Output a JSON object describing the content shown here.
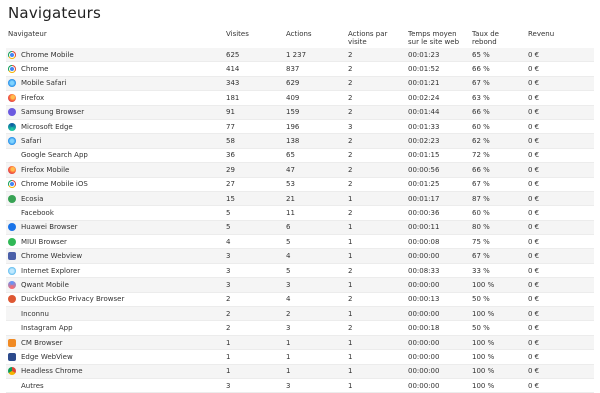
{
  "page": {
    "title": "Navigateurs"
  },
  "table": {
    "columns": [
      "Navigateur",
      "Visites",
      "Actions",
      "Actions par visite",
      "Temps moyen sur le site web",
      "Taux de rebond",
      "Revenu"
    ],
    "rows": [
      {
        "name": "Chrome Mobile",
        "icon": "chrome-icon",
        "visits": "625",
        "actions": "1 237",
        "apv": "2",
        "time": "00:01:23",
        "bounce": "65 %",
        "revenue": "0 €"
      },
      {
        "name": "Chrome",
        "icon": "chrome-icon",
        "visits": "414",
        "actions": "837",
        "apv": "2",
        "time": "00:01:52",
        "bounce": "66 %",
        "revenue": "0 €"
      },
      {
        "name": "Mobile Safari",
        "icon": "safari-icon",
        "visits": "343",
        "actions": "629",
        "apv": "2",
        "time": "00:01:21",
        "bounce": "67 %",
        "revenue": "0 €"
      },
      {
        "name": "Firefox",
        "icon": "firefox-icon",
        "visits": "181",
        "actions": "409",
        "apv": "2",
        "time": "00:02:24",
        "bounce": "63 %",
        "revenue": "0 €"
      },
      {
        "name": "Samsung Browser",
        "icon": "samsung-browser-icon",
        "visits": "91",
        "actions": "159",
        "apv": "2",
        "time": "00:01:44",
        "bounce": "66 %",
        "revenue": "0 €"
      },
      {
        "name": "Microsoft Edge",
        "icon": "edge-icon",
        "visits": "77",
        "actions": "196",
        "apv": "3",
        "time": "00:01:33",
        "bounce": "60 %",
        "revenue": "0 €"
      },
      {
        "name": "Safari",
        "icon": "safari-icon",
        "visits": "58",
        "actions": "138",
        "apv": "2",
        "time": "00:02:23",
        "bounce": "62 %",
        "revenue": "0 €"
      },
      {
        "name": "Google Search App",
        "icon": "",
        "visits": "36",
        "actions": "65",
        "apv": "2",
        "time": "00:01:15",
        "bounce": "72 %",
        "revenue": "0 €"
      },
      {
        "name": "Firefox Mobile",
        "icon": "firefox-icon",
        "visits": "29",
        "actions": "47",
        "apv": "2",
        "time": "00:00:56",
        "bounce": "66 %",
        "revenue": "0 €"
      },
      {
        "name": "Chrome Mobile iOS",
        "icon": "chrome-icon",
        "visits": "27",
        "actions": "53",
        "apv": "2",
        "time": "00:01:25",
        "bounce": "67 %",
        "revenue": "0 €"
      },
      {
        "name": "Ecosia",
        "icon": "ecosia-icon",
        "visits": "15",
        "actions": "21",
        "apv": "1",
        "time": "00:01:17",
        "bounce": "87 %",
        "revenue": "0 €"
      },
      {
        "name": "Facebook",
        "icon": "",
        "visits": "5",
        "actions": "11",
        "apv": "2",
        "time": "00:00:36",
        "bounce": "60 %",
        "revenue": "0 €"
      },
      {
        "name": "Huawei Browser",
        "icon": "huawei-browser-icon",
        "visits": "5",
        "actions": "6",
        "apv": "1",
        "time": "00:00:11",
        "bounce": "80 %",
        "revenue": "0 €"
      },
      {
        "name": "MIUI Browser",
        "icon": "miui-browser-icon",
        "visits": "4",
        "actions": "5",
        "apv": "1",
        "time": "00:00:08",
        "bounce": "75 %",
        "revenue": "0 €"
      },
      {
        "name": "Chrome Webview",
        "icon": "webview-icon",
        "visits": "3",
        "actions": "4",
        "apv": "1",
        "time": "00:00:00",
        "bounce": "67 %",
        "revenue": "0 €"
      },
      {
        "name": "Internet Explorer",
        "icon": "internet-explorer-icon",
        "visits": "3",
        "actions": "5",
        "apv": "2",
        "time": "00:08:33",
        "bounce": "33 %",
        "revenue": "0 €"
      },
      {
        "name": "Qwant Mobile",
        "icon": "qwant-icon",
        "visits": "3",
        "actions": "3",
        "apv": "1",
        "time": "00:00:00",
        "bounce": "100 %",
        "revenue": "0 €"
      },
      {
        "name": "DuckDuckGo Privacy Browser",
        "icon": "duckduckgo-icon",
        "visits": "2",
        "actions": "4",
        "apv": "2",
        "time": "00:00:13",
        "bounce": "50 %",
        "revenue": "0 €"
      },
      {
        "name": "Inconnu",
        "icon": "",
        "visits": "2",
        "actions": "2",
        "apv": "1",
        "time": "00:00:00",
        "bounce": "100 %",
        "revenue": "0 €"
      },
      {
        "name": "Instagram App",
        "icon": "",
        "visits": "2",
        "actions": "3",
        "apv": "2",
        "time": "00:00:18",
        "bounce": "50 %",
        "revenue": "0 €"
      },
      {
        "name": "CM Browser",
        "icon": "cm-browser-icon",
        "visits": "1",
        "actions": "1",
        "apv": "1",
        "time": "00:00:00",
        "bounce": "100 %",
        "revenue": "0 €"
      },
      {
        "name": "Edge WebView",
        "icon": "edge-webview-icon",
        "visits": "1",
        "actions": "1",
        "apv": "1",
        "time": "00:00:00",
        "bounce": "100 %",
        "revenue": "0 €"
      },
      {
        "name": "Headless Chrome",
        "icon": "headless-chrome-icon",
        "visits": "1",
        "actions": "1",
        "apv": "1",
        "time": "00:00:00",
        "bounce": "100 %",
        "revenue": "0 €"
      },
      {
        "name": "Autres",
        "icon": "",
        "visits": "3",
        "actions": "3",
        "apv": "1",
        "time": "00:00:00",
        "bounce": "100 %",
        "revenue": "0 €"
      }
    ]
  }
}
